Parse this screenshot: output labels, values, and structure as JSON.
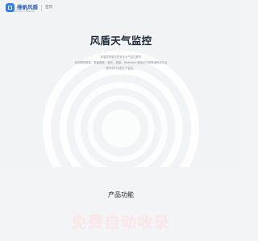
{
  "header": {
    "logo_text": "维帆风盾",
    "logo_subtext": "WEIFAN · FENGDUN",
    "nav_label": "首页"
  },
  "hero": {
    "title": "风盾天气监控",
    "description_lines": [
      "风盾是您最佳的安全天气监控服务",
      "动态跟踪数据，覆盖国家、省份、县级，Webhook 推送天气预警通知到平台",
      "提供实时全国天气监控。"
    ]
  },
  "features": {
    "title": "产品功能"
  },
  "watermark": {
    "text": "免费自动收录"
  },
  "colors": {
    "brand": "#2f7cf6",
    "hero_bg": "#f1f3f5",
    "watermark": "#fbe7e9"
  }
}
